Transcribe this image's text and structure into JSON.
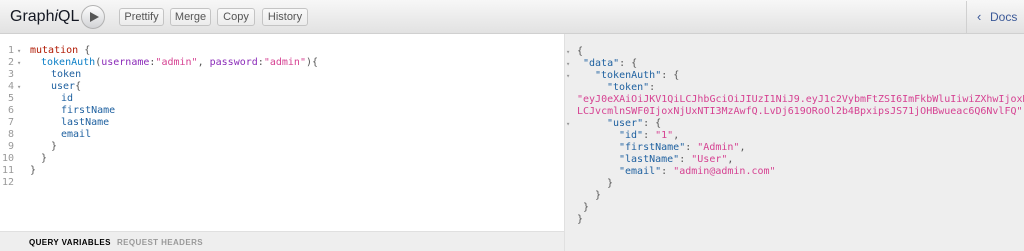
{
  "app": {
    "title_pre": "Graph",
    "title_em": "i",
    "title_post": "QL"
  },
  "toolbar": {
    "prettify_label": "Prettify",
    "merge_label": "Merge",
    "copy_label": "Copy",
    "history_label": "History",
    "docs_label": "Docs",
    "docs_chevron": "‹"
  },
  "query": {
    "line_numbers": [
      "1",
      "2",
      "3",
      "4",
      "5",
      "6",
      "7",
      "8",
      "9",
      "10",
      "11",
      "12"
    ],
    "fold_marker": "▾",
    "tokens": {
      "mutation": "mutation",
      "open_brace": " {",
      "token_auth": "tokenAuth",
      "paren_open": "(",
      "username_arg": "username",
      "colon": ":",
      "username_val": "\"admin\"",
      "comma": ", ",
      "password_arg": "password",
      "password_val": "\"admin\"",
      "paren_close_brace": "){",
      "token": "token",
      "user": "user",
      "user_brace": "{",
      "id": "id",
      "first_name": "firstName",
      "last_name": "lastName",
      "email": "email",
      "close_brace": "}"
    }
  },
  "result": {
    "fold_marker": "▾",
    "lines": {
      "l1": "{",
      "data_key": "\"data\"",
      "data_rest": ": {",
      "token_auth_key": "\"tokenAuth\"",
      "token_auth_rest": ": {",
      "token_key": "\"token\"",
      "token_colon": ":",
      "token_part1": "\"eyJ0eXAiOiJKV1QiLCJhbGciOiJIUzI1NiJ9.eyJ1c2VybmFtZSI6ImFkbWluIiwiZXhwIjoxNjUxNTI3NjA",
      "token_part2": "LCJvcmlnSWF0IjoxNjUxNTI3MzAwfQ.LvDj619ORoOl2b4BpxipsJS71jOHBwueac6Q6NvlFQ\"",
      "token_comma": ",",
      "user_key": "\"user\"",
      "user_rest": ": {",
      "id_key": "\"id\"",
      "id_val": "\"1\"",
      "first_name_key": "\"firstName\"",
      "first_name_val": "\"Admin\"",
      "last_name_key": "\"lastName\"",
      "last_name_val": "\"User\"",
      "email_key": "\"email\"",
      "email_val": "\"admin@admin.com\"",
      "sep": ": ",
      "comma": ",",
      "close": "}"
    }
  },
  "variables_bar": {
    "query_variables_label": "QUERY VARIABLES",
    "request_headers_label": "REQUEST HEADERS"
  }
}
